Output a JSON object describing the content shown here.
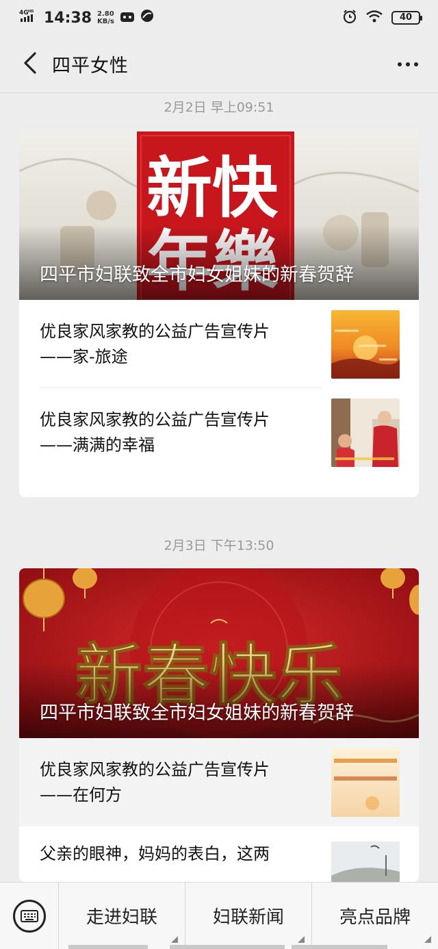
{
  "statusbar": {
    "network": "4G",
    "network_sup": "HD",
    "time": "14:38",
    "speed_value": "2.80",
    "speed_unit": "KB/s",
    "battery": "40"
  },
  "nav": {
    "title": "四平女性"
  },
  "groups": [
    {
      "timestamp": "2月2日 早上09:51",
      "hero": {
        "title": "四平市妇联致全市妇女姐妹的新春贺辞",
        "art_text_1": "新快",
        "art_text_2": "年樂"
      },
      "items": [
        {
          "line1": "优良家风家教的公益广告宣传片",
          "line2": "——家-旅途"
        },
        {
          "line1": "优良家风家教的公益广告宣传片",
          "line2": "——满满的幸福"
        }
      ]
    },
    {
      "timestamp": "2月3日 下午13:50",
      "hero": {
        "title": "四平市妇联致全市妇女姐妹的新春贺辞",
        "art_text_1": "新春快乐"
      },
      "items": [
        {
          "line1": "优良家风家教的公益广告宣传片",
          "line2": "——在何方"
        },
        {
          "line1": "父亲的眼神，妈妈的表白，这两",
          "line2": ""
        }
      ]
    }
  ],
  "bottom_menu": [
    {
      "label": "走进妇联"
    },
    {
      "label": "妇联新闻"
    },
    {
      "label": "亮点品牌"
    }
  ],
  "colors": {
    "background": "#ededed",
    "festive_red": "#c8161d",
    "gold": "#e8c36a"
  },
  "icons": {
    "back": "chevron-left-icon",
    "more": "more-dots-icon",
    "keyboard": "keyboard-icon"
  }
}
